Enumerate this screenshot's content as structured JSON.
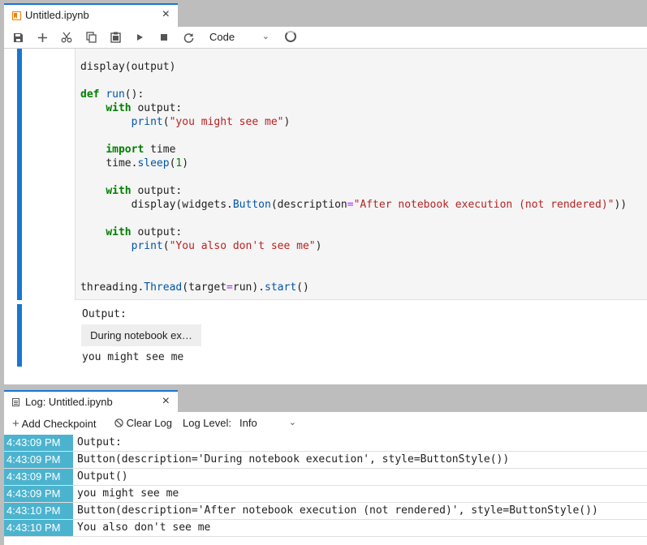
{
  "notebook_tab": {
    "title": "Untitled.ipynb",
    "close": "×"
  },
  "toolbar": {
    "icons": [
      "save-icon",
      "add-cell-icon",
      "cut-icon",
      "copy-icon",
      "paste-icon",
      "run-icon",
      "stop-icon",
      "restart-icon"
    ],
    "cell_type": "Code"
  },
  "code": {
    "l1": "display(output)",
    "l2_kw": "def",
    "l2_fn": "run",
    "l2_rest": "():",
    "l3_kw": "with",
    "l3_rest": " output:",
    "l4_fn": "print",
    "l4_str": "\"you might see me\"",
    "l4_rest": ")",
    "l5_kw": "import",
    "l5_rest": " time",
    "l6_a": "time.",
    "l6_fn": "sleep",
    "l6_b": "(",
    "l6_num": "1",
    "l6_c": ")",
    "l7_kw": "with",
    "l7_rest": " output:",
    "l8_a": "display(widgets.",
    "l8_fn": "Button",
    "l8_b": "(description",
    "l8_op": "=",
    "l8_str": "\"After notebook execution (not rendered)\"",
    "l8_c": "))",
    "l9_kw": "with",
    "l9_rest": " output:",
    "l10_fn": "print",
    "l10_str": "\"You also don't see me\"",
    "l10_rest": ")",
    "l11_a": "threading.",
    "l11_fn": "Thread",
    "l11_b": "(target",
    "l11_op": "=",
    "l11_c": "run).",
    "l11_fn2": "start",
    "l11_d": "()"
  },
  "output": {
    "label": "Output:",
    "button": "During notebook ex…",
    "text": "you might see me"
  },
  "log_tab": {
    "title": "Log: Untitled.ipynb",
    "close": "×"
  },
  "log_toolbar": {
    "add_checkpoint": "Add Checkpoint",
    "clear_log": "Clear Log",
    "log_level_label": "Log Level:",
    "log_level_value": "Info"
  },
  "log_rows": [
    {
      "time": "4:43:09 PM",
      "message": "Output:"
    },
    {
      "time": "4:43:09 PM",
      "message": "Button(description='During notebook execution', style=ButtonStyle())"
    },
    {
      "time": "4:43:09 PM",
      "message": "Output()"
    },
    {
      "time": "4:43:09 PM",
      "message": "you might see me"
    },
    {
      "time": "4:43:10 PM",
      "message": "Button(description='After notebook execution (not rendered)', style=ButtonStyle())"
    },
    {
      "time": "4:43:10 PM",
      "message": "You also don't see me"
    }
  ],
  "colors": {
    "accent": "#1976d2",
    "log_time_bg": "#4cb3cf",
    "tab_icon": "#f57c00"
  }
}
